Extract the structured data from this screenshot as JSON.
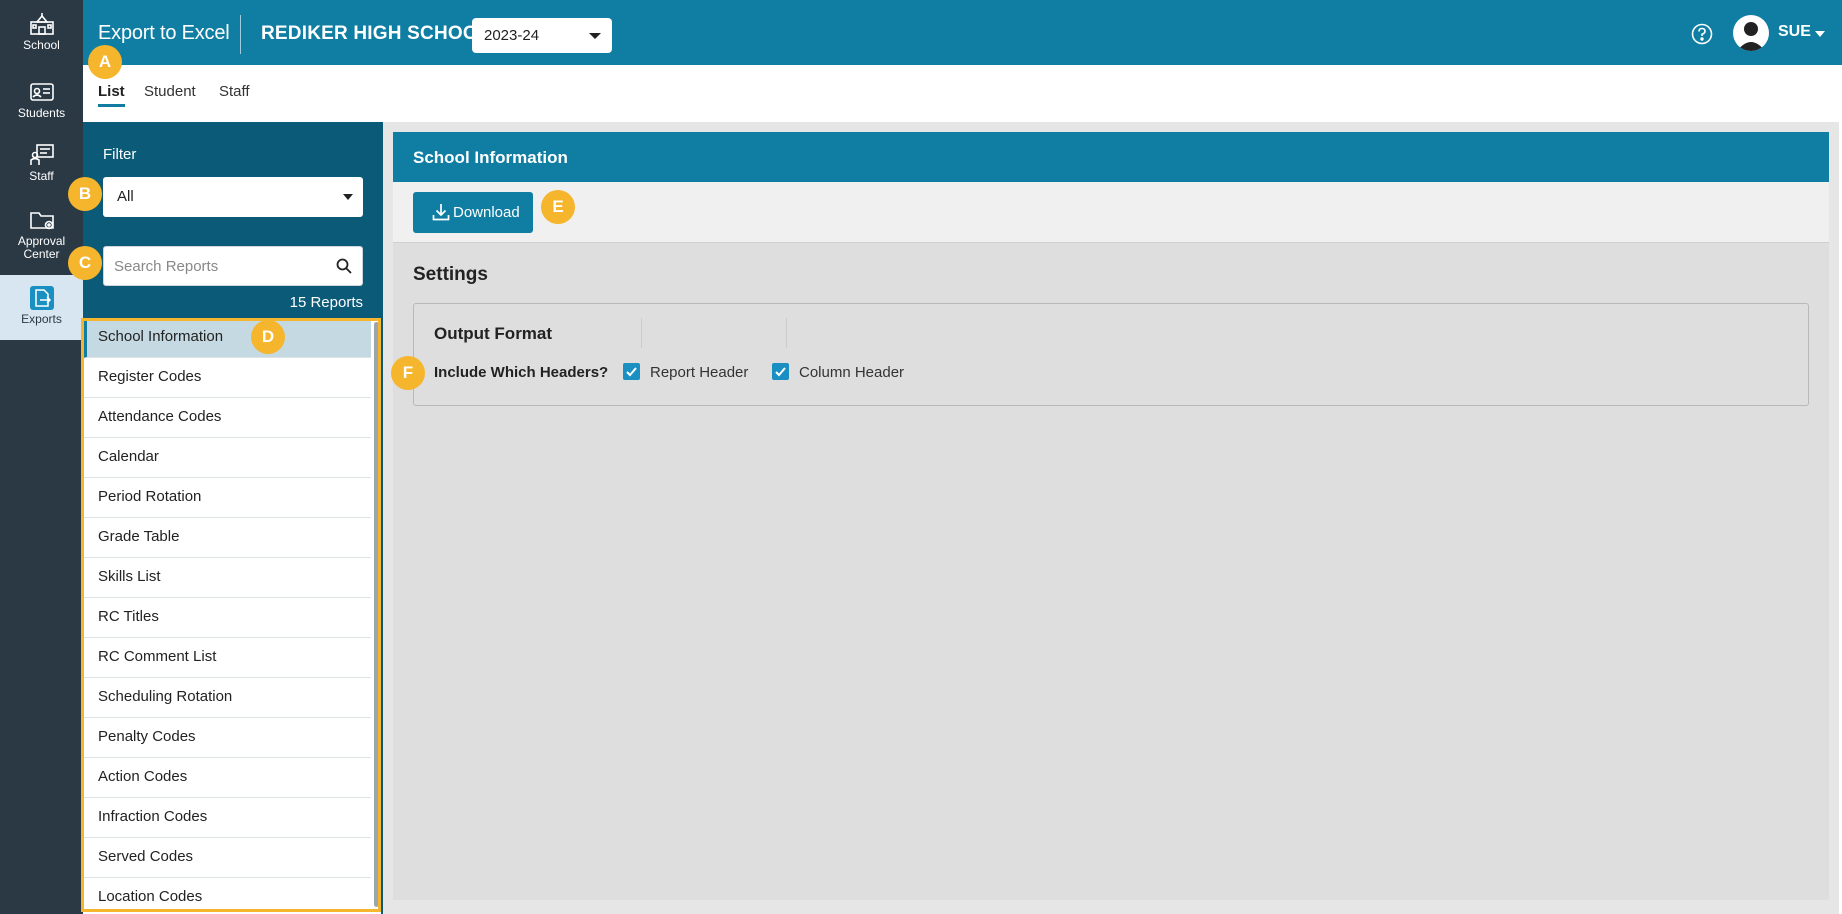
{
  "nav": {
    "items": [
      {
        "label": "School",
        "icon": "school-icon"
      },
      {
        "label": "Students",
        "icon": "id-card-icon"
      },
      {
        "label": "Staff",
        "icon": "staff-board-icon"
      },
      {
        "label": "Approval",
        "label2": "Center",
        "icon": "folder-gear-icon"
      },
      {
        "label": "Exports",
        "icon": "export-file-icon"
      }
    ]
  },
  "header": {
    "title": "Export to Excel",
    "school": "REDIKER HIGH SCHOOL",
    "year": "2023-24",
    "user": "SUE"
  },
  "tabs": [
    "List",
    "Student",
    "Staff"
  ],
  "panel": {
    "filter_label": "Filter",
    "filter_value": "All",
    "search_placeholder": "Search Reports",
    "count": "15 Reports",
    "reports": [
      "School Information",
      "Register Codes",
      "Attendance Codes",
      "Calendar",
      "Period Rotation",
      "Grade Table",
      "Skills List",
      "RC Titles",
      "RC Comment List",
      "Scheduling Rotation",
      "Penalty Codes",
      "Action Codes",
      "Infraction Codes",
      "Served Codes",
      "Location Codes"
    ]
  },
  "main": {
    "card_title": "School Information",
    "download_label": "Download",
    "settings_title": "Settings",
    "output_format_title": "Output Format",
    "headers_label": "Include Which Headers?",
    "report_header": "Report Header",
    "column_header": "Column Header",
    "report_header_checked": true,
    "column_header_checked": true
  },
  "markers": {
    "a": "A",
    "b": "B",
    "c": "C",
    "d": "D",
    "e": "E",
    "f": "F"
  },
  "colors": {
    "brand": "#0f7ea2",
    "nav_bg": "#2b3944",
    "panel_bg": "#0b5a78",
    "marker": "#f5b52c"
  }
}
